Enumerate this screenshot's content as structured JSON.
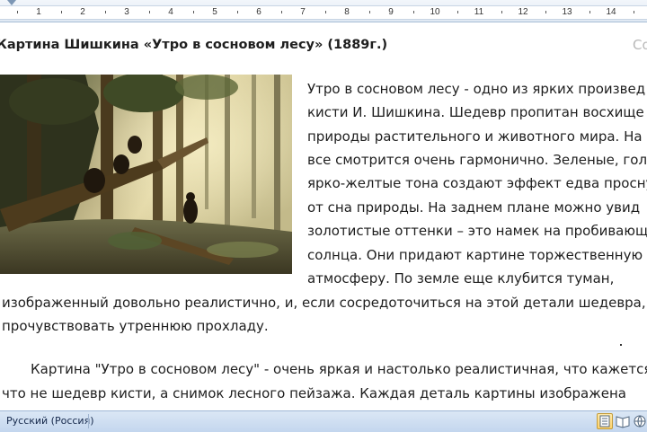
{
  "ruler": {
    "labels": [
      "1",
      "2",
      "3",
      "4",
      "5",
      "6",
      "7",
      "8",
      "9",
      "10",
      "11",
      "12",
      "13",
      "14"
    ]
  },
  "document": {
    "title": "Картина Шишкина «Утро в сосновом лесу» (1889г.)",
    "corner_text": "Со",
    "image_alt": "Картина «Утро в сосновом лесу»",
    "paragraph1_lines": [
      "Утро в сосновом лесу - одно из ярких произвед",
      "кисти И. Шишкина. Шедевр пропитан восхище",
      "природы растительного и животного мира. На",
      "все смотрится очень гармонично. Зеленые, гол",
      "ярко-желтые тона создают эффект едва просну",
      "от сна природы. На заднем плане можно увид",
      "золотистые оттенки – это намек на пробивающ",
      "солнца. Они придают картине торжественную",
      "атмосферу. По земле еще клубится туман,",
      "изображенный довольно реалистично, и, если сосредоточиться на этой детали шедевра,",
      "прочувствовать утреннюю прохладу."
    ],
    "paragraph2_lines": [
      "Картина \"Утро в сосновом лесу\" - очень яркая и настолько реалистичная, что кажется, б",
      "что не шедевр кисти, а снимок лесного пейзажа. Каждая деталь картины изображена"
    ]
  },
  "statusbar": {
    "language": "Русский (Россия)"
  },
  "view_buttons": [
    "print-layout-view",
    "full-screen-reading-view",
    "web-layout-view"
  ]
}
